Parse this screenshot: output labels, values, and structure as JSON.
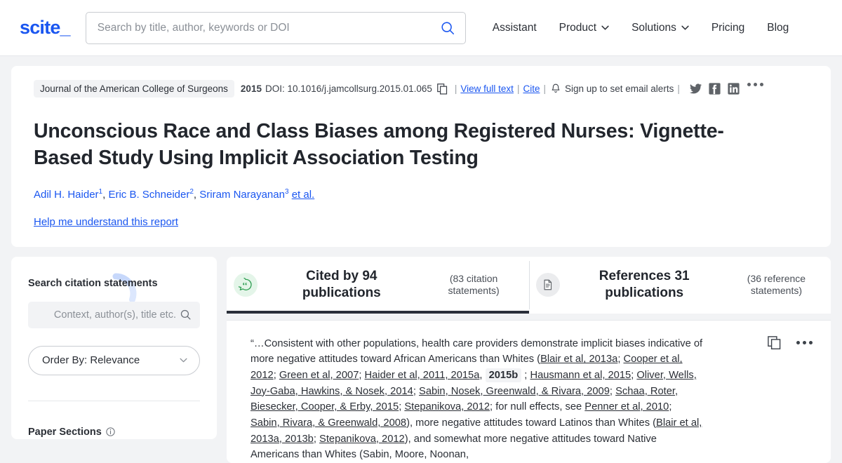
{
  "header": {
    "logo": "scite_",
    "search_placeholder": "Search by title, author, keywords or DOI",
    "search_value": "",
    "nav": [
      {
        "label": "Assistant",
        "has_caret": false
      },
      {
        "label": "Product",
        "has_caret": true
      },
      {
        "label": "Solutions",
        "has_caret": true
      },
      {
        "label": "Pricing",
        "has_caret": false
      },
      {
        "label": "Blog",
        "has_caret": false
      }
    ]
  },
  "paper": {
    "journal": "Journal of the American College of Surgeons",
    "year": "2015",
    "doi": "DOI: 10.1016/j.jamcollsurg.2015.01.065",
    "view_full_text": "View full text",
    "cite": "Cite",
    "email_alerts": "Sign up to set email alerts",
    "separator": "|",
    "title": "Unconscious Race and Class Biases among Registered Nurses: Vignette-Based Study Using Implicit Association Testing",
    "authors": [
      {
        "name": "Adil H. Haider",
        "sup": "1"
      },
      {
        "name": "Eric B. Schneider",
        "sup": "2"
      },
      {
        "name": "Sriram Narayanan",
        "sup": "3"
      }
    ],
    "et_al": "et al.",
    "help_link": "Help me understand this report",
    "social_icons": [
      "twitter-icon",
      "facebook-icon",
      "linkedin-icon"
    ]
  },
  "sidebar": {
    "title": "Search citation statements",
    "search_placeholder": "Context, author(s), title etc.",
    "search_value": "",
    "order_by": "Order By: Relevance",
    "paper_sections": "Paper Sections"
  },
  "tabs": [
    {
      "icon": "quote-bubble-icon",
      "main": "Cited by 94 publications",
      "sub": "(83 citation statements)",
      "active": true
    },
    {
      "icon": "document-icon",
      "main": "References 31 publications",
      "sub": "(36 reference statements)",
      "active": false
    }
  ],
  "statement": {
    "segments": [
      {
        "t": "“…Consistent with other populations, health care providers demonstrate implicit biases indicative of more negative attitudes toward African Americans than Whites (",
        "s": "plain"
      },
      {
        "t": "Blair et al, 2013a",
        "s": "link"
      },
      {
        "t": "; ",
        "s": "plain"
      },
      {
        "t": "Cooper et al, 2012",
        "s": "link"
      },
      {
        "t": "; ",
        "s": "plain"
      },
      {
        "t": "Green et al, 2007",
        "s": "link"
      },
      {
        "t": "; ",
        "s": "plain"
      },
      {
        "t": "Haider et al, 2011, 2015a",
        "s": "link"
      },
      {
        "t": ", ",
        "s": "plain"
      },
      {
        "t": "2015b",
        "s": "highlight"
      },
      {
        "t": " ; ",
        "s": "plain"
      },
      {
        "t": "Hausmann et al, 2015",
        "s": "link"
      },
      {
        "t": "; ",
        "s": "plain"
      },
      {
        "t": "Oliver, Wells, Joy-Gaba, Hawkins, & Nosek, 2014",
        "s": "link"
      },
      {
        "t": "; ",
        "s": "plain"
      },
      {
        "t": "Sabin, Nosek, Greenwald, & Rivara, 2009",
        "s": "link"
      },
      {
        "t": "; ",
        "s": "plain"
      },
      {
        "t": "Schaa, Roter, Biesecker, Cooper, & Erby, 2015",
        "s": "link"
      },
      {
        "t": "; ",
        "s": "plain"
      },
      {
        "t": "Stepanikova, 2012",
        "s": "link"
      },
      {
        "t": "; for null effects, see ",
        "s": "plain"
      },
      {
        "t": "Penner et al, 2010",
        "s": "link"
      },
      {
        "t": "; ",
        "s": "plain"
      },
      {
        "t": "Sabin, Rivara, & Greenwald, 2008",
        "s": "link"
      },
      {
        "t": "), more negative attitudes toward Latinos than Whites (",
        "s": "plain"
      },
      {
        "t": "Blair et al, 2013a, 2013b",
        "s": "link"
      },
      {
        "t": "; ",
        "s": "plain"
      },
      {
        "t": "Stepanikova, 2012",
        "s": "link"
      },
      {
        "t": "), and somewhat more negative attitudes toward Native Americans than Whites (Sabin, Moore, Noonan,",
        "s": "plain"
      }
    ]
  },
  "colors": {
    "brand_blue": "#1a56f0",
    "page_bg": "#f2f3f5",
    "text": "#2b2f36",
    "active_tab_underline": "#2b303a",
    "cited_badge_green": "#2e9e52",
    "cited_badge_bg": "#e4f5e9"
  }
}
